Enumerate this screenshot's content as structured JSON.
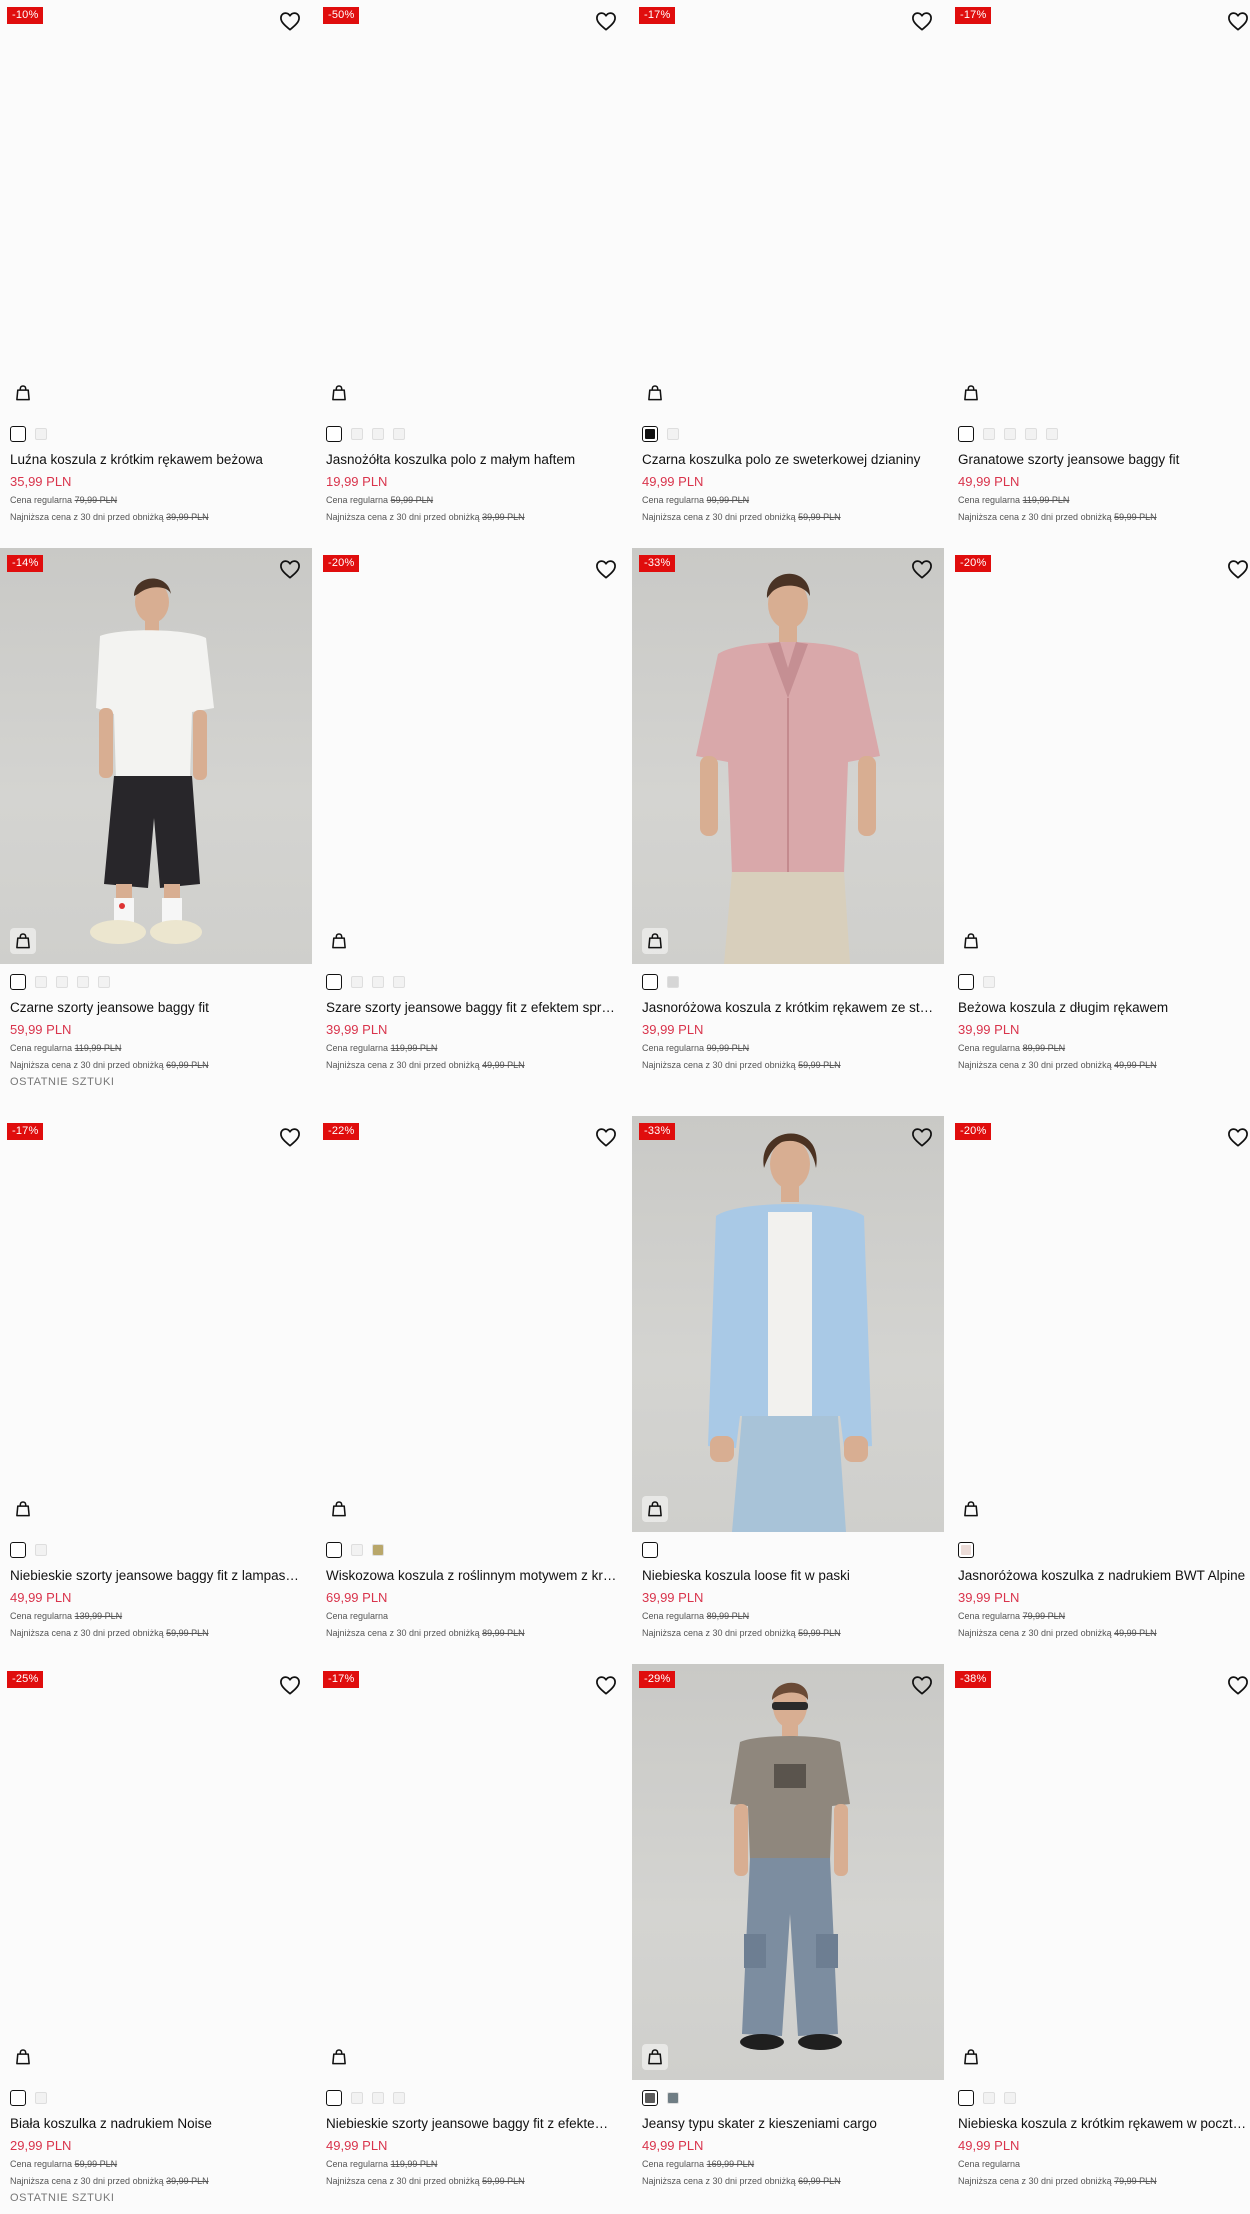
{
  "labels": {
    "regular_price": "Cena regularna",
    "lowest_price": "Najniższa cena z 30 dni przed obniżką",
    "last_items": "OSTATNIE SZTUKI"
  },
  "products": [
    {
      "discount": "-10%",
      "title": "Luźna koszula z krótkim rękawem beżowa",
      "price": "35,99 PLN",
      "regular": "79,99 PLN",
      "lowest": "39,99 PLN",
      "swatches": [
        "#ffffff",
        "#f2f2f2"
      ],
      "photo": "",
      "last": ""
    },
    {
      "discount": "-50%",
      "title": "Jasnożółta koszulka polo z małym haftem",
      "price": "19,99 PLN",
      "regular": "59,99 PLN",
      "lowest": "39,99 PLN",
      "swatches": [
        "#ffffff",
        "#f2f2f2",
        "#f2f2f2",
        "#f2f2f2"
      ],
      "photo": "",
      "last": ""
    },
    {
      "discount": "-17%",
      "title": "Czarna koszulka polo ze sweterkowej dzianiny",
      "price": "49,99 PLN",
      "regular": "99,99 PLN",
      "lowest": "59,99 PLN",
      "swatches": [
        "#111111",
        "#f2f2f2"
      ],
      "photo": "",
      "last": ""
    },
    {
      "discount": "-17%",
      "title": "Granatowe szorty jeansowe baggy fit",
      "price": "49,99 PLN",
      "regular": "119,99 PLN",
      "lowest": "59,99 PLN",
      "swatches": [
        "#ffffff",
        "#f2f2f2",
        "#f2f2f2",
        "#f2f2f2",
        "#f2f2f2"
      ],
      "photo": "",
      "last": ""
    },
    {
      "discount": "-14%",
      "title": "Czarne szorty jeansowe baggy fit",
      "price": "59,99 PLN",
      "regular": "119,99 PLN",
      "lowest": "69,99 PLN",
      "swatches": [
        "#ffffff",
        "#f2f2f2",
        "#f2f2f2",
        "#f2f2f2",
        "#f2f2f2"
      ],
      "photo": "white-tee-black-shorts",
      "last": "OSTATNIE SZTUKI"
    },
    {
      "discount": "-20%",
      "title": "Szare szorty jeansowe baggy fit z efektem sprania",
      "price": "39,99 PLN",
      "regular": "119,99 PLN",
      "lowest": "49,99 PLN",
      "swatches": [
        "#ffffff",
        "#f2f2f2",
        "#f2f2f2",
        "#f2f2f2"
      ],
      "photo": "",
      "last": ""
    },
    {
      "discount": "-33%",
      "title": "Jasnoróżowa koszula z krótkim rękawem ze strukturą",
      "price": "39,99 PLN",
      "regular": "99,99 PLN",
      "lowest": "59,99 PLN",
      "swatches": [
        "#ffffff",
        "#d6d6d6"
      ],
      "photo": "pink-shirt",
      "last": ""
    },
    {
      "discount": "-20%",
      "title": "Beżowa koszula z długim rękawem",
      "price": "39,99 PLN",
      "regular": "89,99 PLN",
      "lowest": "49,99 PLN",
      "swatches": [
        "#ffffff",
        "#f2f2f2"
      ],
      "photo": "",
      "last": ""
    },
    {
      "discount": "-17%",
      "title": "Niebieskie szorty jeansowe baggy fit z lampasami",
      "price": "49,99 PLN",
      "regular": "139,99 PLN",
      "lowest": "59,99 PLN",
      "swatches": [
        "#ffffff",
        "#f2f2f2"
      ],
      "photo": "",
      "last": ""
    },
    {
      "discount": "-22%",
      "title": "Wiskozowa koszula z roślinnym motywem z krótkim rękawem",
      "price": "69,99 PLN",
      "regular": "",
      "lowest": "89,99 PLN",
      "swatches": [
        "#ffffff",
        "#f2f2f2",
        "#b9a76a"
      ],
      "photo": "",
      "last": ""
    },
    {
      "discount": "-33%",
      "title": "Niebieska koszula loose fit w paski",
      "price": "39,99 PLN",
      "regular": "89,99 PLN",
      "lowest": "59,99 PLN",
      "swatches": [
        "#ffffff"
      ],
      "photo": "blue-shirt",
      "last": ""
    },
    {
      "discount": "-20%",
      "title": "Jasnoróżowa koszulka z nadrukiem BWT Alpine",
      "price": "39,99 PLN",
      "regular": "79,99 PLN",
      "lowest": "49,99 PLN",
      "swatches": [
        "#ecdcd8"
      ],
      "photo": "",
      "last": ""
    },
    {
      "discount": "-25%",
      "title": "Biała koszulka z nadrukiem Noise",
      "price": "29,99 PLN",
      "regular": "59,99 PLN",
      "lowest": "39,99 PLN",
      "swatches": [
        "#ffffff",
        "#f2f2f2"
      ],
      "photo": "",
      "last": "OSTATNIE SZTUKI"
    },
    {
      "discount": "-17%",
      "title": "Niebieskie szorty jeansowe baggy fit z efektem sprania",
      "price": "49,99 PLN",
      "regular": "119,99 PLN",
      "lowest": "59,99 PLN",
      "swatches": [
        "#ffffff",
        "#f2f2f2",
        "#f2f2f2",
        "#f2f2f2"
      ],
      "photo": "",
      "last": ""
    },
    {
      "discount": "-29%",
      "title": "Jeansy typu skater z kieszeniami cargo",
      "price": "49,99 PLN",
      "regular": "169,99 PLN",
      "lowest": "69,99 PLN",
      "swatches": [
        "#5b5b5b",
        "#6f7d84"
      ],
      "photo": "cargo-jeans",
      "last": ""
    },
    {
      "discount": "-38%",
      "title": "Niebieska koszula z krótkim rękawem w pocztówkowy wzór",
      "price": "49,99 PLN",
      "regular": "",
      "lowest": "79,99 PLN",
      "swatches": [
        "#ffffff",
        "#f2f2f2",
        "#f2f2f2"
      ],
      "photo": "",
      "last": ""
    }
  ]
}
